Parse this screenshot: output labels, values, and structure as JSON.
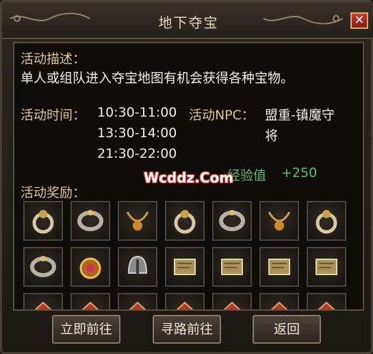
{
  "window": {
    "title": "地下夺宝",
    "close_label": "✕"
  },
  "description": {
    "label": "活动描述：",
    "text": "单人或组队进入夺宝地图有机会获得各种宝物。"
  },
  "time": {
    "label": "活动时间：",
    "slots": [
      "10:30-11:00",
      "13:30-14:00",
      "21:30-22:00"
    ]
  },
  "npc": {
    "label": "活动NPC：",
    "name_line1": "盟重-镇魔守",
    "name_line2": "将"
  },
  "exp": {
    "label": "经验值",
    "value": "+250"
  },
  "rewards": {
    "label": "活动奖励：",
    "items": [
      "ring-item-icon",
      "bracelet-item-icon",
      "necklace-item-icon",
      "ring-item-icon",
      "bracelet-item-icon",
      "necklace-item-icon",
      "ring-item-icon",
      "bracelet-item-icon",
      "medal-item-icon",
      "helmet-item-icon",
      "scroll-item-icon",
      "scroll-item-icon",
      "scroll-item-icon",
      "scroll-item-icon",
      "gem-item-icon",
      "gem-item-icon",
      "gem-item-icon",
      "gem-item-icon",
      "gem-item-icon",
      "gem-item-icon",
      "gem-item-icon"
    ]
  },
  "watermark": "Wcddz.Com",
  "buttons": {
    "go_now": "立即前往",
    "pathfind": "寻路前往",
    "back": "返回"
  },
  "colors": {
    "label": "#e2c48a",
    "text": "#f2efe8",
    "exp": "#5fbf6a"
  }
}
